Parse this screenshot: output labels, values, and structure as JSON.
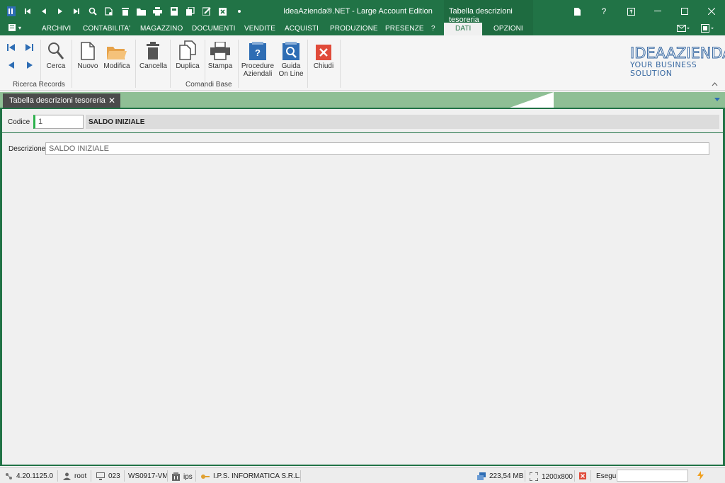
{
  "window": {
    "title": "IdeaAzienda®.NET - Large Account Edition",
    "context_tab_title": "Tabella descrizioni tesoreria"
  },
  "menu": {
    "tabs": [
      "ARCHIVI",
      "CONTABILITA'",
      "MAGAZZINO",
      "DOCUMENTI",
      "VENDITE",
      "ACQUISTI",
      "PRODUZIONE",
      "PRESENZE",
      "?"
    ],
    "active_tab": "DATI",
    "options_tab": "OPZIONI"
  },
  "ribbon": {
    "search_label": "Cerca",
    "new_label": "Nuovo",
    "edit_label": "Modifica",
    "delete_label": "Cancella",
    "duplicate_label": "Duplica",
    "print_label": "Stampa",
    "procedures_label_1": "Procedure",
    "procedures_label_2": "Aziendali",
    "guide_label_1": "Guida",
    "guide_label_2": "On Line",
    "close_label": "Chiudi",
    "group_ricerca": "Ricerca Records",
    "group_comandi": "Comandi Base"
  },
  "logo": {
    "line1": "IDEAAZIENDA",
    "line2": "YOUR BUSINESS SOLUTION"
  },
  "document_tab": {
    "label": "Tabella descrizioni tesoreria"
  },
  "form": {
    "codice_label": "Codice",
    "codice_value": "1",
    "header_description": "SALDO INIZIALE",
    "descrizione_label": "Descrizione",
    "descrizione_value": "SALDO INIZIALE"
  },
  "status": {
    "version": "4.20.1125.0",
    "user": "root",
    "terminal": "023",
    "machine": "WS0917-VM",
    "database": "ips",
    "company": "I.P.S. INFORMATICA S.R.L.",
    "memory": "223,54 MB",
    "resolution": "1200x800",
    "esegui_label": "Esegui"
  },
  "colors": {
    "brand_green": "#217346",
    "strip_green": "#8fbf95",
    "accent_blue": "#2e6db4",
    "close_red": "#e04b3a",
    "folder_orange": "#f0b45a"
  }
}
